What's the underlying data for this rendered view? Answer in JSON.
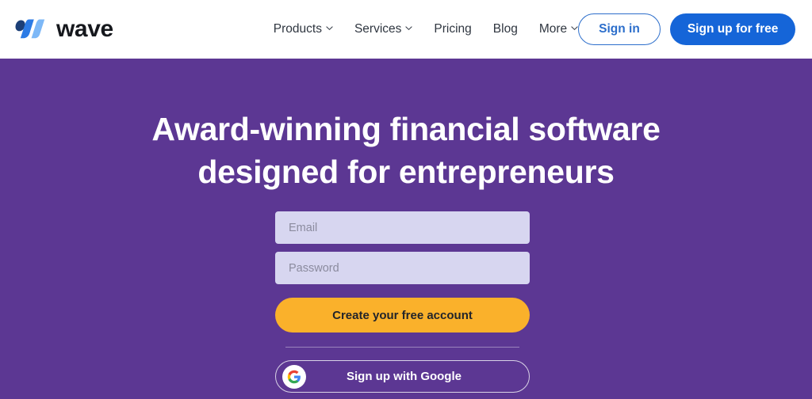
{
  "colors": {
    "hero_background": "#5C3793",
    "header_background": "#FFFFFF",
    "primary_blue": "#1565D8",
    "signin_blue": "#2C6ECB",
    "cta_orange": "#FAB12B",
    "input_background": "#D7D6F0",
    "headline_text": "#FFFFFF"
  },
  "header": {
    "brand": {
      "name": "wave",
      "logo_icon": "wave-logo-icon"
    },
    "nav": [
      {
        "label": "Products",
        "has_dropdown": true,
        "icon": "chevron-down-icon"
      },
      {
        "label": "Services",
        "has_dropdown": true,
        "icon": "chevron-down-icon"
      },
      {
        "label": "Pricing",
        "has_dropdown": false
      },
      {
        "label": "Blog",
        "has_dropdown": false
      },
      {
        "label": "More",
        "has_dropdown": true,
        "icon": "chevron-down-icon"
      }
    ],
    "sign_in_label": "Sign in",
    "sign_up_label": "Sign up for free"
  },
  "hero": {
    "headline_line1": "Award-winning financial software",
    "headline_line2": "designed for entrepreneurs",
    "form": {
      "email_value": "",
      "email_placeholder": "Email",
      "password_value": "",
      "password_placeholder": "Password",
      "create_account_label": "Create your free account",
      "google_label": "Sign up with Google",
      "google_icon": "google-g-icon"
    }
  }
}
